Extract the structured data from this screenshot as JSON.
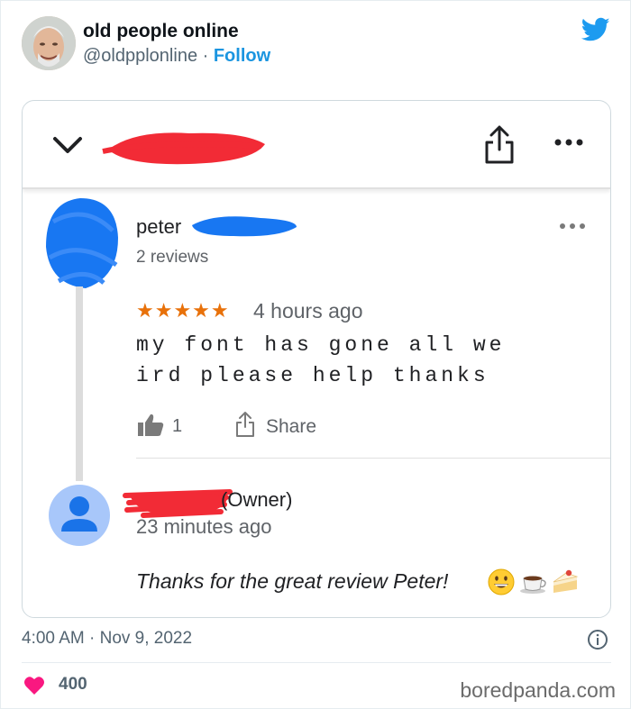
{
  "tweet": {
    "display_name": "old people online",
    "handle": "@oldpplonline",
    "separator": " · ",
    "follow_label": "Follow",
    "timestamp": "4:00 AM · Nov 9, 2022",
    "like_count": "400",
    "watermark": "boredpanda.com"
  },
  "review": {
    "reviewer_name": "peter",
    "reviewer_meta": "2 reviews",
    "stars": "★★★★★",
    "rating": 5,
    "time": "4 hours ago",
    "text_line_1": "my font has gone all we",
    "text_line_2": "ird please help thanks",
    "like_count": "1",
    "share_label": "Share"
  },
  "owner": {
    "label": "(Owner)",
    "time": "23 minutes ago",
    "reply": "Thanks for the great review Peter!"
  },
  "icons": {
    "brand": "twitter-icon",
    "collapse": "chevron-down-icon",
    "share": "share-icon",
    "more": "more-horizontal-icon",
    "like": "thumbs-up-icon",
    "info": "info-icon",
    "heart": "heart-icon"
  },
  "colors": {
    "twitter_blue": "#1b95e0",
    "star_orange": "#e8710a",
    "heart_red": "#f91880",
    "redaction_red": "#f22b36",
    "redaction_blue": "#1877f2"
  }
}
